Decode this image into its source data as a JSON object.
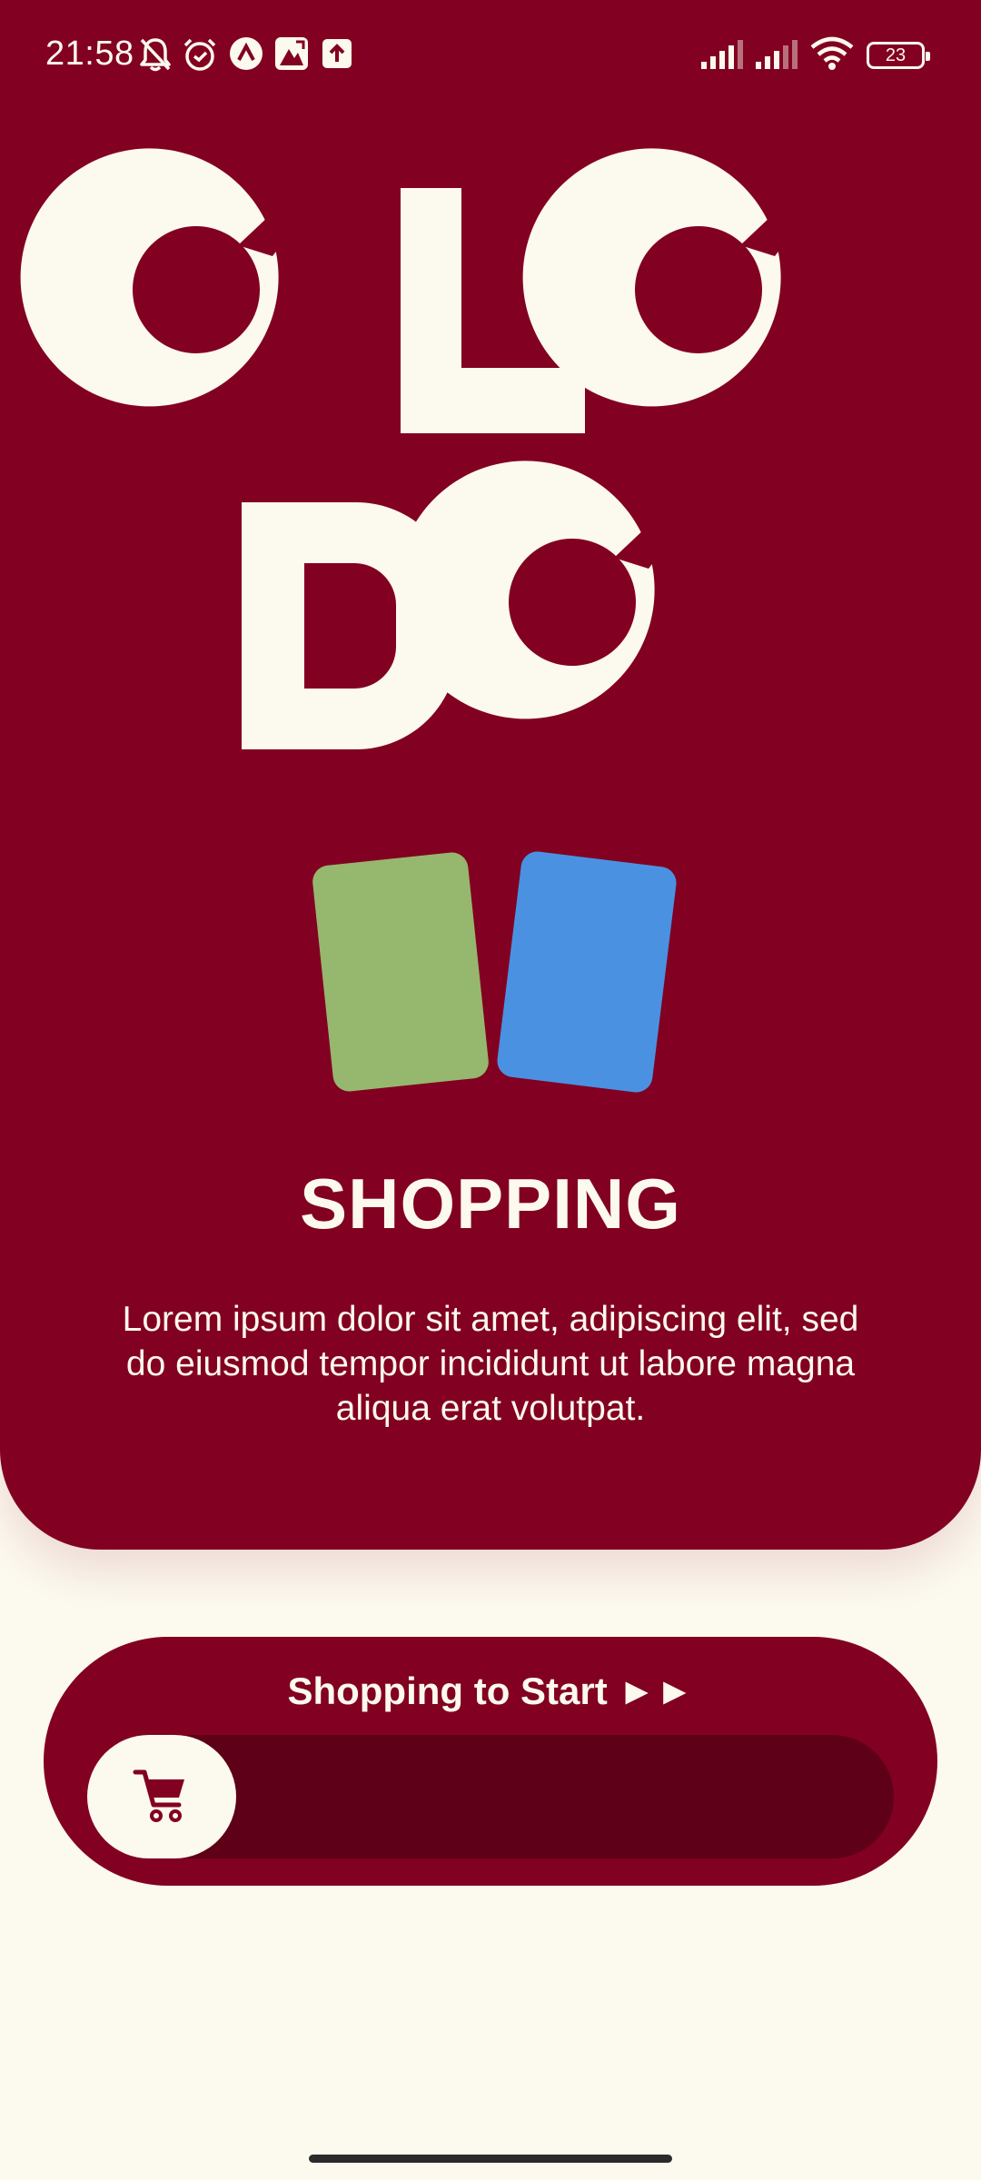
{
  "status_bar": {
    "time": "21:58",
    "icons": [
      "mute-bell-icon",
      "alarm-icon",
      "app-notification-icon",
      "gallery-icon",
      "upload-icon"
    ],
    "right_icons": [
      "signal-icon",
      "signal-icon",
      "wifi-icon",
      "battery-icon"
    ],
    "battery_level": "23"
  },
  "logo": {
    "alt": "OLODO"
  },
  "hero": {
    "title": "SHOPPING",
    "description": "Lorem ipsum dolor sit amet, adipiscing elit, sed do eiusmod tempor incididunt ut labore magna aliqua erat volutpat."
  },
  "swipe_button": {
    "label": "Shopping to Start ►►",
    "knob_icon": "cart-icon",
    "progress": 0
  },
  "colors": {
    "primary": "#820021",
    "track": "#5E0017",
    "cream": "#FCF9EE",
    "card_green": "#96B76E",
    "card_blue": "#4A91E2"
  }
}
